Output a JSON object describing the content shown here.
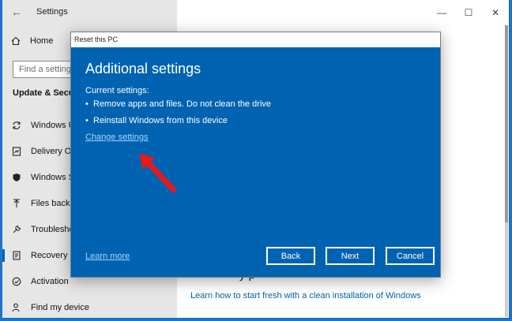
{
  "window": {
    "title": "Settings",
    "back_glyph": "←",
    "controls": [
      "—",
      "☐",
      "✕"
    ]
  },
  "sidebar": {
    "home_label": "Home",
    "search_placeholder": "Find a setting",
    "section_title": "Update & Securit",
    "items": [
      {
        "label": "Windows Up",
        "icon": "sync-icon"
      },
      {
        "label": "Delivery Opt",
        "icon": "delivery-optimization-icon"
      },
      {
        "label": "Windows Se",
        "icon": "shield-icon"
      },
      {
        "label": "Files backup",
        "icon": "backup-arrow-icon"
      },
      {
        "label": "Troublesho",
        "icon": "wrench-icon"
      },
      {
        "label": "Recovery",
        "icon": "recovery-icon"
      },
      {
        "label": "Activation",
        "icon": "activation-check-icon"
      },
      {
        "label": "Find my device",
        "icon": "person-location-icon"
      }
    ],
    "active_index": 5
  },
  "main": {
    "heading_fragment": "y p",
    "clean_install_link": "Learn how to start fresh with a clean installation of Windows"
  },
  "dialog": {
    "title": "Reset this PC",
    "heading": "Additional settings",
    "current_label": "Current settings:",
    "bullets": [
      "Remove apps and files. Do not clean the drive",
      "Reinstall Windows from this device"
    ],
    "change_link": "Change settings",
    "learn_more": "Learn more",
    "buttons": {
      "back": "Back",
      "next": "Next",
      "cancel": "Cancel"
    }
  },
  "colors": {
    "dialog_bg": "#0063b1",
    "link_light": "#a9d3ff",
    "accent": "#0063b1",
    "annotation_arrow": "#e8191c"
  }
}
